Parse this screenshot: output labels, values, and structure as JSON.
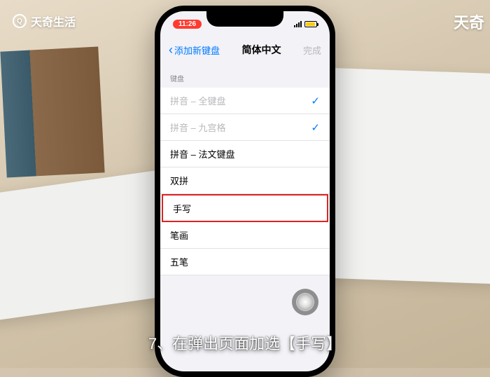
{
  "watermark": {
    "left": "天奇生活",
    "right": "天奇"
  },
  "status": {
    "time": "11:26"
  },
  "nav": {
    "back": "添加新键盘",
    "title": "简体中文",
    "done": "完成"
  },
  "section": {
    "header": "键盘"
  },
  "rows": [
    {
      "label": "拼音 – 全键盘",
      "selected": true
    },
    {
      "label": "拼音 – 九宫格",
      "selected": true
    },
    {
      "label": "拼音 – 法文键盘",
      "selected": false
    },
    {
      "label": "双拼",
      "selected": false
    },
    {
      "label": "手写",
      "selected": false,
      "highlighted": true
    },
    {
      "label": "笔画",
      "selected": false
    },
    {
      "label": "五笔",
      "selected": false
    }
  ],
  "caption": "7、在弹出页面加选【手写】"
}
